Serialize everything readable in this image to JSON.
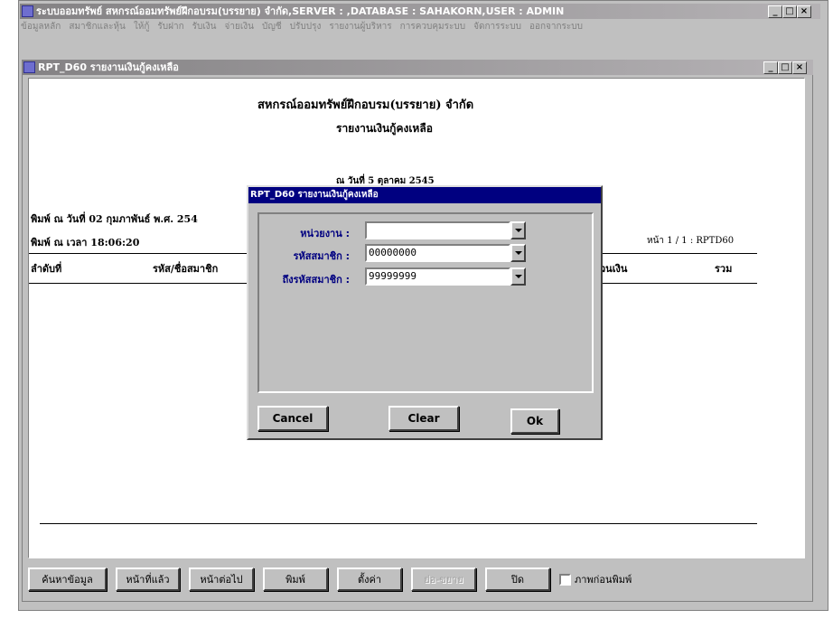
{
  "app": {
    "title": "ระบบออมทรัพย์ สหกรณ์ออมทรัพย์ฝึกอบรม(บรรยาย) จำกัด,SERVER : ,DATABASE : SAHAKORN,USER : ADMIN"
  },
  "menu": [
    "ข้อมูลหลัก",
    "สมาชิกและหุ้น",
    "ให้กู้",
    "รับฝาก",
    "รับเงิน",
    "จ่ายเงิน",
    "บัญชี",
    "ปรับปรุง",
    "รายงานผู้บริหาร",
    "การควบคุมระบบ",
    "จัดการระบบ",
    "ออกจากระบบ"
  ],
  "window": {
    "title": "RPT_D60 รายงานเงินกู้คงเหลือ"
  },
  "report": {
    "org_name": "สหกรณ์ออมทรัพย์ฝึกอบรม(บรรยาย) จำกัด",
    "report_title": "รายงานเงินกู้คงเหลือ",
    "as_of": "ณ วันที่ 5 ตุลาคม 2545",
    "print_date": "พิมพ์ ณ วันที่ 02 กุมภาพันธ์ พ.ศ. 254",
    "print_time": "พิมพ์ ณ เวลา 18:06:20",
    "page_info": "หน้า 1 / 1 : RPTD60",
    "col_seq": "ลำดับที่",
    "col_member": "รหัส/ชื่อสมาชิก",
    "col_amount": "วนเงิน",
    "col_total": "รวม"
  },
  "dialog": {
    "title": "RPT_D60 รายงานเงินกู้คงเหลือ",
    "unit_label": "หน่วยงาน :",
    "unit_value": "",
    "member_from_label": "รหัสสมาชิก :",
    "member_from_value": "00000000",
    "member_to_label": "ถึงรหัสสมาชิก :",
    "member_to_value": "99999999",
    "cancel": "Cancel",
    "clear": "Clear",
    "ok": "Ok"
  },
  "toolbar": {
    "search": "ค้นหาข้อมูล",
    "prev": "หน้าที่แล้ว",
    "next": "หน้าต่อไป",
    "print": "พิมพ์",
    "settings": "ตั้งค่า",
    "zoom": "ย่อ-ขยาย",
    "close": "ปิด",
    "preview": "ภาพก่อนพิมพ์"
  }
}
